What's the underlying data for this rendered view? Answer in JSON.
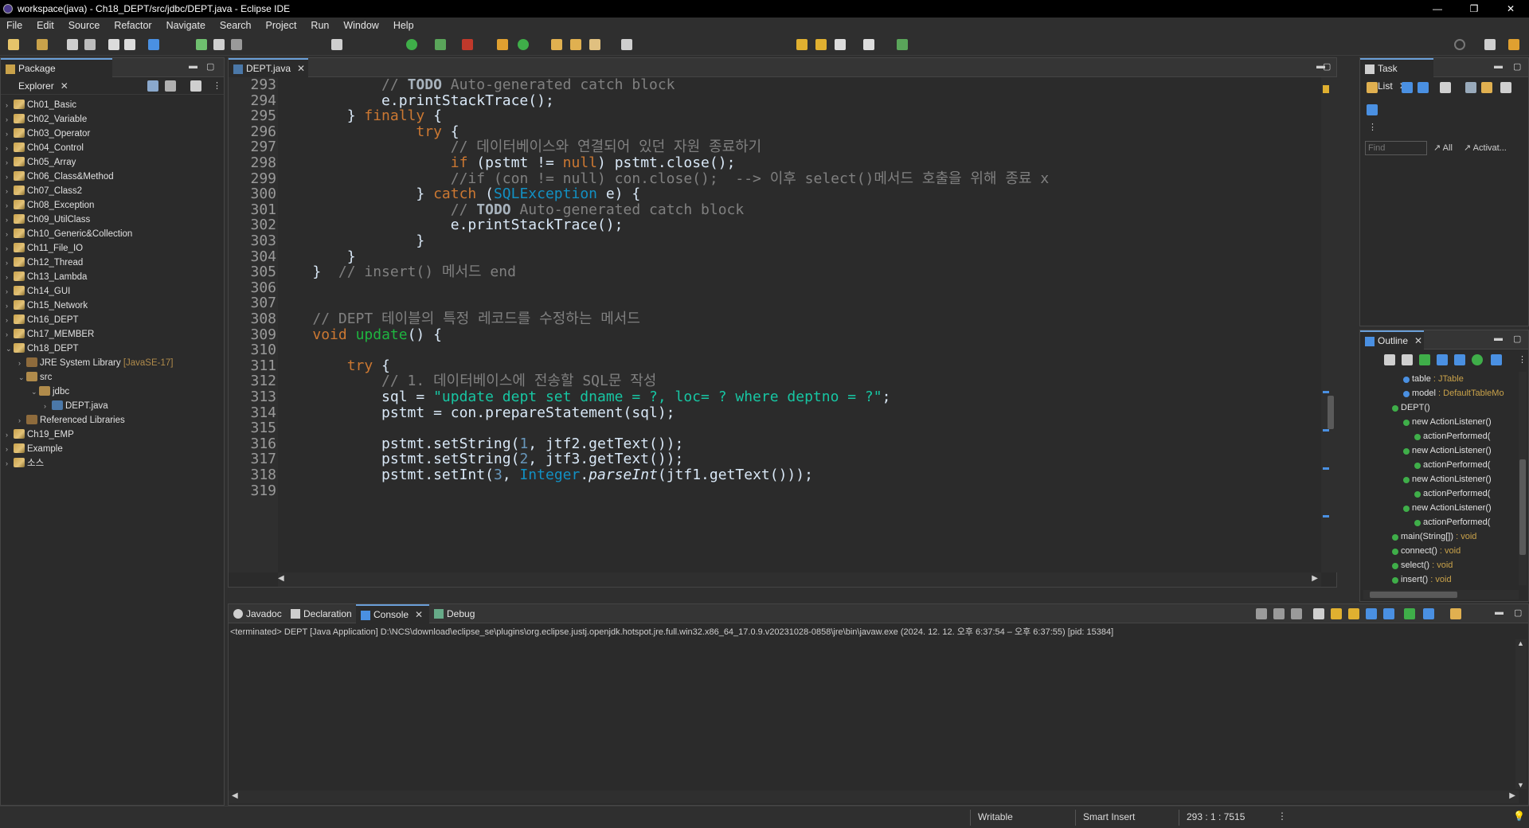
{
  "window": {
    "title": "workspace(java) - Ch18_DEPT/src/jdbc/DEPT.java - Eclipse IDE",
    "buttons": [
      "—",
      "❐",
      "✕"
    ]
  },
  "menu": [
    "File",
    "Edit",
    "Source",
    "Refactor",
    "Navigate",
    "Search",
    "Project",
    "Run",
    "Window",
    "Help"
  ],
  "package_explorer": {
    "title": "Package Explorer",
    "items": [
      {
        "label": "Ch01_Basic",
        "level": 0,
        "arrow": "›",
        "icon": "project"
      },
      {
        "label": "Ch02_Variable",
        "level": 0,
        "arrow": "›",
        "icon": "project"
      },
      {
        "label": "Ch03_Operator",
        "level": 0,
        "arrow": "›",
        "icon": "project"
      },
      {
        "label": "Ch04_Control",
        "level": 0,
        "arrow": "›",
        "icon": "project"
      },
      {
        "label": "Ch05_Array",
        "level": 0,
        "arrow": "›",
        "icon": "project"
      },
      {
        "label": "Ch06_Class&Method",
        "level": 0,
        "arrow": "›",
        "icon": "project"
      },
      {
        "label": "Ch07_Class2",
        "level": 0,
        "arrow": "›",
        "icon": "project"
      },
      {
        "label": "Ch08_Exception",
        "level": 0,
        "arrow": "›",
        "icon": "project"
      },
      {
        "label": "Ch09_UtilClass",
        "level": 0,
        "arrow": "›",
        "icon": "project"
      },
      {
        "label": "Ch10_Generic&Collection",
        "level": 0,
        "arrow": "›",
        "icon": "project"
      },
      {
        "label": "Ch11_File_IO",
        "level": 0,
        "arrow": "›",
        "icon": "project"
      },
      {
        "label": "Ch12_Thread",
        "level": 0,
        "arrow": "›",
        "icon": "project"
      },
      {
        "label": "Ch13_Lambda",
        "level": 0,
        "arrow": "›",
        "icon": "project"
      },
      {
        "label": "Ch14_GUI",
        "level": 0,
        "arrow": "›",
        "icon": "project"
      },
      {
        "label": "Ch15_Network",
        "level": 0,
        "arrow": "›",
        "icon": "project"
      },
      {
        "label": "Ch16_DEPT",
        "level": 0,
        "arrow": "›",
        "icon": "project"
      },
      {
        "label": "Ch17_MEMBER",
        "level": 0,
        "arrow": "›",
        "icon": "project"
      },
      {
        "label": "Ch18_DEPT",
        "level": 0,
        "arrow": "⌄",
        "icon": "project"
      },
      {
        "label": "JRE System Library",
        "suffix": "[JavaSE-17]",
        "level": 1,
        "arrow": "›",
        "icon": "jar"
      },
      {
        "label": "src",
        "level": 1,
        "arrow": "⌄",
        "icon": "package"
      },
      {
        "label": "jdbc",
        "level": 2,
        "arrow": "⌄",
        "icon": "package"
      },
      {
        "label": "DEPT.java",
        "level": 3,
        "arrow": "›",
        "icon": "java"
      },
      {
        "label": "Referenced Libraries",
        "level": 1,
        "arrow": "›",
        "icon": "jar"
      },
      {
        "label": "Ch19_EMP",
        "level": 0,
        "arrow": "›",
        "icon": "project"
      },
      {
        "label": "Example",
        "level": 0,
        "arrow": "›",
        "icon": "project"
      },
      {
        "label": "소스",
        "level": 0,
        "arrow": "›",
        "icon": "project"
      }
    ]
  },
  "editor": {
    "tab": "DEPT.java",
    "line_numbers": [
      "293",
      "294",
      "295",
      "296",
      "297",
      "298",
      "299",
      "300",
      "301",
      "302",
      "303",
      "304",
      "305",
      "306",
      "307",
      "308",
      "309",
      "310",
      "311",
      "312",
      "313",
      "314",
      "315",
      "316",
      "317",
      "318",
      "319"
    ],
    "lines": [
      "            // TODO Auto-generated catch block",
      "            e.printStackTrace();",
      "        } finally {",
      "                try {",
      "                    // 데이터베이스와 연결되어 있던 자원 종료하기",
      "                    if (pstmt != null) pstmt.close();",
      "                    //if (con != null) con.close();  --> 이후 select()메서드 호출을 위해 종료 x",
      "                } catch (SQLException e) {",
      "                    // TODO Auto-generated catch block",
      "                    e.printStackTrace();",
      "                }",
      "        }",
      "    }  // insert() 메서드 end",
      "",
      "",
      "    // DEPT 테이블의 특정 레코드를 수정하는 메서드",
      "    void update() {",
      "",
      "        try {",
      "            // 1. 데이터베이스에 전송할 SQL문 작성",
      "            sql = \"update dept set dname = ?, loc= ? where deptno = ?\";",
      "            pstmt = con.prepareStatement(sql);",
      "",
      "            pstmt.setString(1, jtf2.getText());",
      "            pstmt.setString(2, jtf3.getText());",
      "            pstmt.setInt(3, Integer.parseInt(jtf1.getText()));",
      ""
    ]
  },
  "task_list": {
    "title": "Task List",
    "find_placeholder": "Find",
    "all_label": "All",
    "activate_label": "Activat..."
  },
  "outline": {
    "title": "Outline",
    "items": [
      {
        "name": "table",
        "type": " : JTable",
        "level": 1
      },
      {
        "name": "model",
        "type": " : DefaultTableMo",
        "level": 1
      },
      {
        "name": "DEPT()",
        "type": "",
        "level": 0
      },
      {
        "name": "new ActionListener()",
        "type": "",
        "level": 1
      },
      {
        "name": "actionPerformed(",
        "type": "",
        "level": 2
      },
      {
        "name": "new ActionListener()",
        "type": "",
        "level": 1
      },
      {
        "name": "actionPerformed(",
        "type": "",
        "level": 2
      },
      {
        "name": "new ActionListener()",
        "type": "",
        "level": 1
      },
      {
        "name": "actionPerformed(",
        "type": "",
        "level": 2
      },
      {
        "name": "new ActionListener()",
        "type": "",
        "level": 1
      },
      {
        "name": "actionPerformed(",
        "type": "",
        "level": 2
      },
      {
        "name": "main(String[])",
        "type": " : void",
        "level": 0
      },
      {
        "name": "connect()",
        "type": " : void",
        "level": 0
      },
      {
        "name": "select()",
        "type": " : void",
        "level": 0
      },
      {
        "name": "insert()",
        "type": " : void",
        "level": 0
      }
    ]
  },
  "bottom": {
    "tabs": [
      "Javadoc",
      "Declaration",
      "Console",
      "Debug"
    ],
    "active_tab": "Console",
    "console_header": "<terminated> DEPT [Java Application] D:\\NCS\\download\\eclipse_se\\plugins\\org.eclipse.justj.openjdk.hotspot.jre.full.win32.x86_64_17.0.9.v20231028-0858\\jre\\bin\\javaw.exe  (2024. 12. 12. 오후 6:37:54 – 오후 6:37:55) [pid: 15384]"
  },
  "status": {
    "writable": "Writable",
    "insert_mode": "Smart Insert",
    "position": "293 : 1 : 7515"
  }
}
